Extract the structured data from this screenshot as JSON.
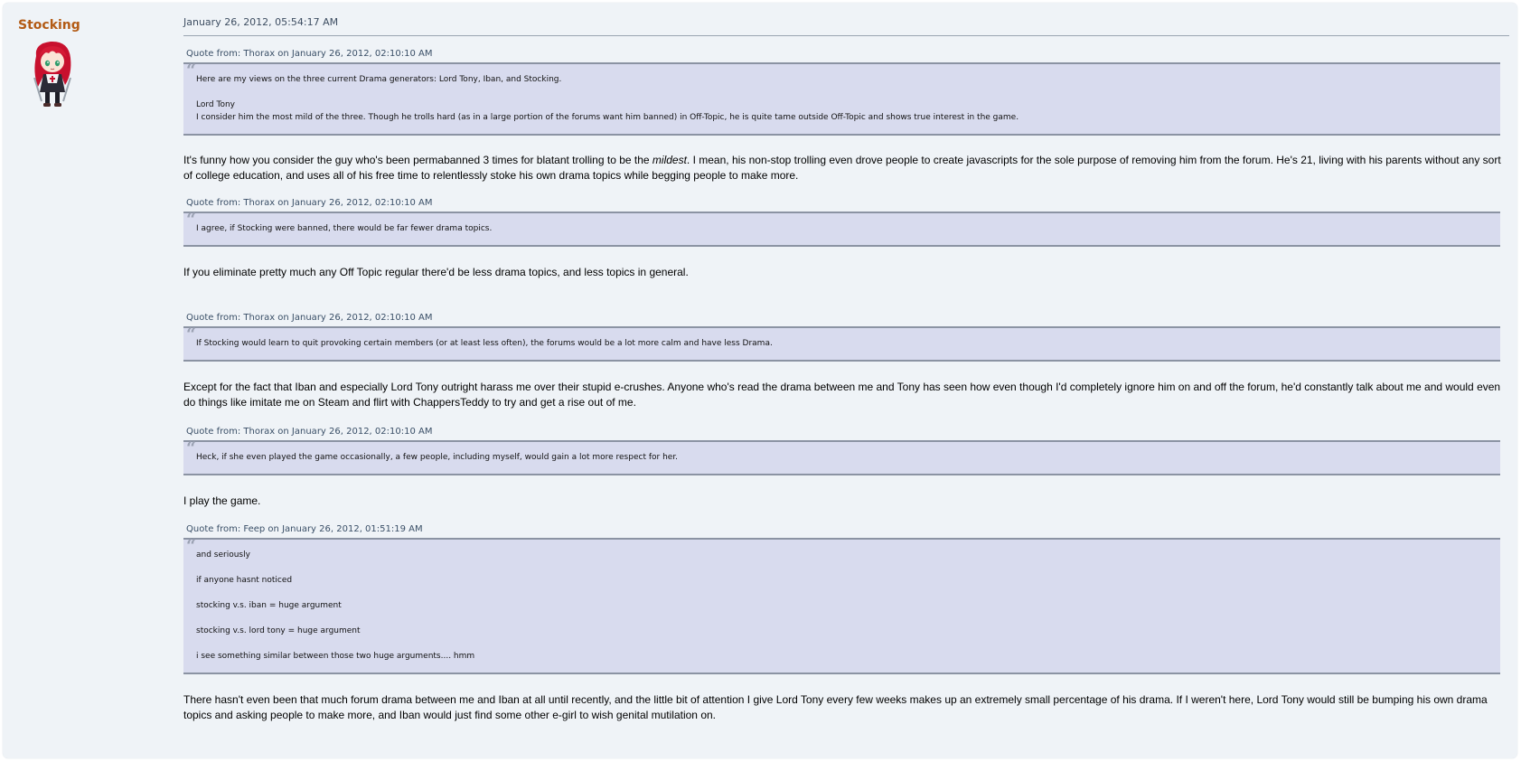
{
  "poster": {
    "name": "Stocking",
    "avatar_icon": "anime-girl-avatar"
  },
  "post": {
    "date": "January 26, 2012, 05:54:17 AM"
  },
  "blocks": [
    {
      "quote_header": "Quote from: Thorax on January 26, 2012, 02:10:10 AM",
      "quote_lines": [
        "Here are my views on the three current Drama generators: Lord Tony, Iban, and Stocking.",
        "Lord Tony",
        "I consider him the most mild of the three. Though he trolls hard (as in a large portion of the forums want him banned) in Off-Topic, he is quite tame outside Off-Topic and shows true interest in the game."
      ],
      "reply_before": "It's funny how you consider the guy who's been permabanned 3 times for blatant trolling to be the ",
      "reply_emphasis": "mildest",
      "reply_after": ". I mean, his non-stop trolling even drove people to create javascripts for the sole purpose of removing him from the forum. He's 21, living with his parents without any sort of college education, and uses all of his free time to relentlessly stoke his own drama topics while begging people to make more."
    },
    {
      "quote_header": "Quote from: Thorax on January 26, 2012, 02:10:10 AM",
      "quote": "I agree, if Stocking were banned, there would be far fewer drama topics.",
      "reply": "If you eliminate pretty much any Off Topic regular there'd be less drama topics, and less topics in general."
    },
    {
      "quote_header": "Quote from: Thorax on January 26, 2012, 02:10:10 AM",
      "quote": "If Stocking would learn to quit provoking certain members (or at least less often), the forums would be a lot more calm and have less Drama.",
      "reply": "Except for the fact that Iban and especially Lord Tony outright harass me over their stupid e-crushes. Anyone who's read the drama between me and Tony has seen how even though I'd completely ignore him on and off the forum, he'd constantly talk about me and would even do things like imitate me on Steam and flirt with ChappersTeddy to try and get a rise out of me."
    },
    {
      "quote_header": "Quote from: Thorax on January 26, 2012, 02:10:10 AM",
      "quote": "Heck, if she even played the game occasionally, a few people, including myself, would gain a lot more respect for her.",
      "reply": "I play the game."
    },
    {
      "quote_header": "Quote from: Feep on January 26, 2012, 01:51:19 AM",
      "quote_lines": [
        "and seriously",
        "if anyone hasnt noticed",
        "stocking v.s. iban = huge argument",
        "stocking v.s. lord tony = huge argument",
        "i see something similar between those two huge arguments.... hmm"
      ],
      "reply": "There hasn't even been that much forum drama between me and Iban at all until recently, and the little bit of attention I give Lord Tony every few weeks makes up an extremely small percentage of his drama. If I weren't here, Lord Tony would still be bumping his own drama topics and asking people to make more, and Iban would just find some other e-girl to wish genital mutilation on."
    }
  ],
  "colors": {
    "post_bg": "#eff3f7",
    "quote_bg": "#d8dbee",
    "quote_border": "#8b93a3",
    "poster_name": "#b35b15",
    "link": "#3a4f67"
  }
}
